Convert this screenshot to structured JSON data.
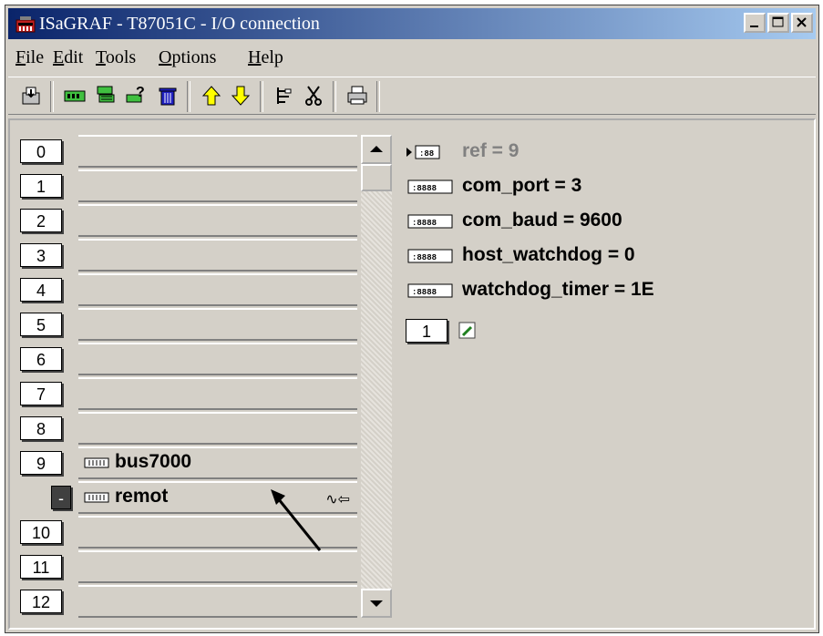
{
  "window": {
    "title": "ISaGRAF - T87051C - I/O connection",
    "minimize_icon": "minimize-icon",
    "maximize_icon": "maximize-icon",
    "close_icon": "close-icon"
  },
  "menu": [
    {
      "label": "File",
      "hotkey": "F"
    },
    {
      "label": "Edit",
      "hotkey": "E"
    },
    {
      "label": "Tools",
      "hotkey": "T"
    },
    {
      "label": "Options",
      "hotkey": "O"
    },
    {
      "label": "Help",
      "hotkey": "H"
    }
  ],
  "toolbar_icons": [
    "exit-icon",
    "board-icon",
    "equipment-icon",
    "parameters-icon",
    "delete-icon",
    "move-up-icon",
    "move-down-icon",
    "insert-icon",
    "cut-icon",
    "print-icon"
  ],
  "slots": [
    {
      "num": "0",
      "label": ""
    },
    {
      "num": "1",
      "label": ""
    },
    {
      "num": "2",
      "label": ""
    },
    {
      "num": "3",
      "label": ""
    },
    {
      "num": "4",
      "label": ""
    },
    {
      "num": "5",
      "label": ""
    },
    {
      "num": "6",
      "label": ""
    },
    {
      "num": "7",
      "label": ""
    },
    {
      "num": "8",
      "label": ""
    },
    {
      "num": "9",
      "label": "bus7000"
    },
    {
      "num": "-",
      "label": "remot",
      "tail": "∿⇦"
    },
    {
      "num": "10",
      "label": ""
    },
    {
      "num": "11",
      "label": ""
    },
    {
      "num": "12",
      "label": ""
    }
  ],
  "params": [
    {
      "text": "ref = 9",
      "color": "#808080"
    },
    {
      "text": "com_port = 3",
      "color": "#000000"
    },
    {
      "text": "com_baud = 9600",
      "color": "#000000"
    },
    {
      "text": "host_watchdog = 0",
      "color": "#000000"
    },
    {
      "text": "watchdog_timer = 1E",
      "color": "#000000"
    }
  ],
  "channel": {
    "num": "1"
  }
}
